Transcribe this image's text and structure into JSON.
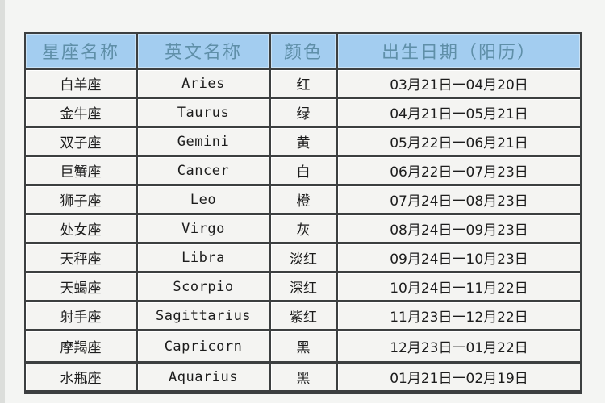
{
  "table": {
    "headers": [
      "星座名称",
      "英文名称",
      "颜色",
      "出生日期（阳历）"
    ],
    "rows": [
      {
        "cn": "白羊座",
        "en": "Aries",
        "color": "红",
        "dates": "03月21日一04月20日"
      },
      {
        "cn": "金牛座",
        "en": "Taurus",
        "color": "绿",
        "dates": "04月21日一05月21日"
      },
      {
        "cn": "双子座",
        "en": "Gemini",
        "color": "黄",
        "dates": "05月22日一06月21日"
      },
      {
        "cn": "巨蟹座",
        "en": "Cancer",
        "color": "白",
        "dates": "06月22日一07月23日"
      },
      {
        "cn": "狮子座",
        "en": "Leo",
        "color": "橙",
        "dates": "07月24日一08月23日"
      },
      {
        "cn": "处女座",
        "en": "Virgo",
        "color": "灰",
        "dates": "08月24日一09月23日"
      },
      {
        "cn": "天秤座",
        "en": "Libra",
        "color": "淡红",
        "dates": "09月24日一10月23日"
      },
      {
        "cn": "天蝎座",
        "en": "Scorpio",
        "color": "深红",
        "dates": "10月24日一11月22日"
      },
      {
        "cn": "射手座",
        "en": "Sagittarius",
        "color": "紫红",
        "dates": "11月23日一12月22日"
      },
      {
        "cn": "摩羯座",
        "en": "Capricorn",
        "color": "黑",
        "dates": "12月23日一01月22日"
      },
      {
        "cn": "水瓶座",
        "en": "Aquarius",
        "color": "黑",
        "dates": "01月21日一02月19日"
      }
    ]
  },
  "colors": {
    "header_bg": "#a3cdf0",
    "header_text": "#5f8fa8",
    "border": "#3c3f40",
    "cell_bg": "#f4f4f2"
  }
}
